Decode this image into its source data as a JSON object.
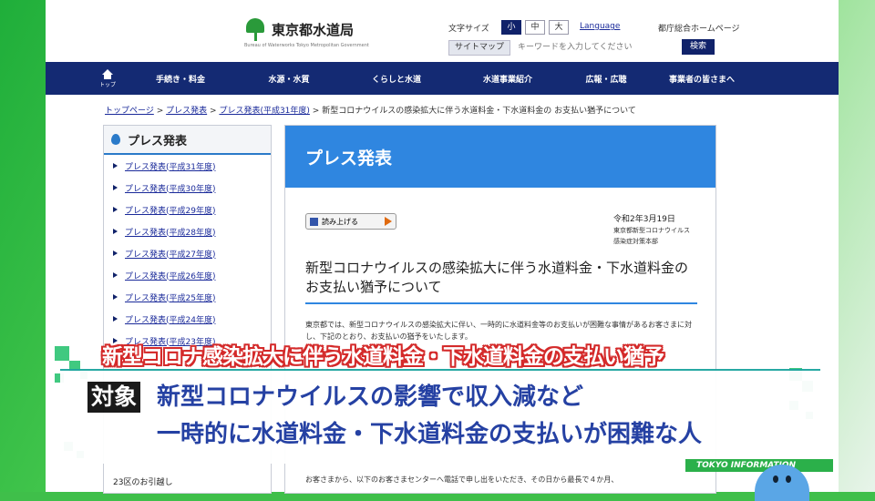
{
  "header": {
    "site_name": "東京都水道局",
    "site_sub": "Bureau of Waterworks Tokyo Metropolitan Government",
    "font_size_label": "文字サイズ",
    "font_sizes": [
      "小",
      "中",
      "大"
    ],
    "language_link": "Language",
    "gov_home": "都庁総合ホームページ",
    "sitemap": "サイトマップ",
    "search_placeholder": "キーワードを入力してください",
    "search_button": "検索"
  },
  "nav": {
    "home": "トップ",
    "items": [
      "手続き・料金",
      "水源・水質",
      "くらしと水道",
      "水道事業紹介",
      "広報・広聴",
      "事業者の皆さまへ"
    ]
  },
  "breadcrumb": {
    "items": [
      "トップページ",
      "プレス発表",
      "プレス発表(平成31年度)"
    ],
    "current": "新型コロナウイルスの感染拡大に伴う水道料金・下水道料金の お支払い猶予について",
    "separator": ">"
  },
  "sidebar": {
    "title": "プレス発表",
    "items": [
      "プレス発表(平成31年度)",
      "プレス発表(平成30年度)",
      "プレス発表(平成29年度)",
      "プレス発表(平成28年度)",
      "プレス発表(平成27年度)",
      "プレス発表(平成26年度)",
      "プレス発表(平成25年度)",
      "プレス発表(平成24年度)",
      "プレス発表(平成23年度)"
    ],
    "footer_item": "23区のお引越し"
  },
  "main": {
    "heading": "プレス発表",
    "read_button": "読み上げる",
    "date": "令和2年3月19日",
    "org1": "東京都新型コロナウイルス",
    "org2": "感染症対策本部",
    "title": "新型コロナウイルスの感染拡大に伴う水道料金・下水道料金のお支払い猶予について",
    "body": "東京都では、新型コロナウイルスの感染拡大に伴い、一時的に水道料金等のお支払いが困難な事情があるお客さまに対し、下記のとおり、お支払いの猶予をいたします。",
    "body2": "お客さまから、以下のお客さまセンターへ電話で申し出をいただき、その日から最長で４か月、"
  },
  "overlay": {
    "banner_title": "新型コロナ感染拡大に伴う水道料金・下水道料金の支払い猶予",
    "tag": "対象",
    "line1": "新型コロナウイルスの影響で収入減など",
    "line2": "一時的に水道料金・下水道料金の支払いが困難な人",
    "channel": "TOKYO INFORMATION"
  },
  "colors": {
    "nav_bg": "#142a73",
    "accent_blue": "#2f86e0",
    "banner_red": "#d42a2a",
    "caption_blue": "#1d3aa0",
    "tv_green": "#2bb04a"
  }
}
